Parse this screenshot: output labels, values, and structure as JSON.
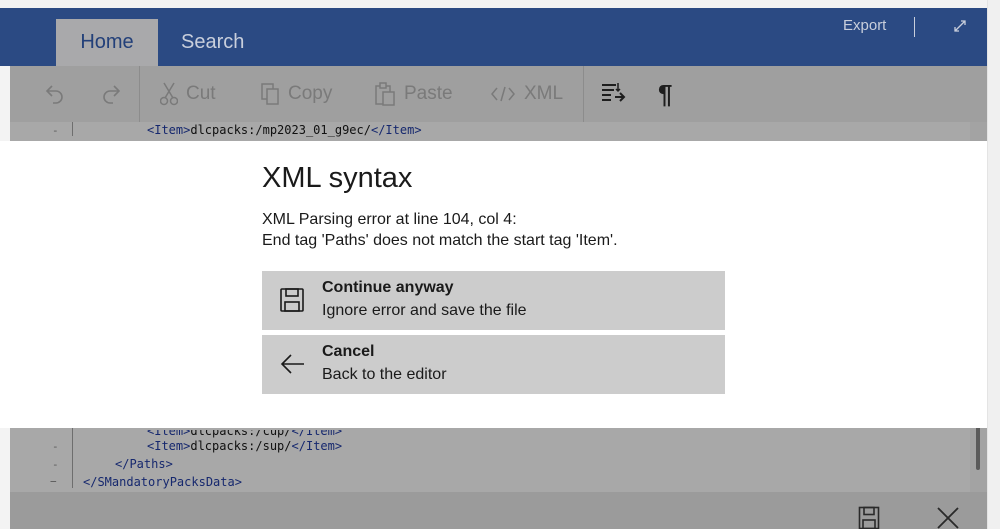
{
  "header": {
    "tabs": [
      {
        "label": "Home",
        "active": true
      },
      {
        "label": "Search",
        "active": false
      }
    ],
    "export_label": "Export",
    "expand_icon": "expand-icon",
    "colors": {
      "bar": "#2b4a83",
      "active_tab": "#a9a9ab",
      "active_tab_text": "#234079"
    }
  },
  "toolbar": {
    "undo_icon": "undo-icon",
    "redo_icon": "redo-icon",
    "cut_label": "Cut",
    "copy_label": "Copy",
    "paste_label": "Paste",
    "xml_label": "XML",
    "format_icon": "format-document-icon",
    "pilcrow": "¶"
  },
  "editor": {
    "lines_top": [
      {
        "open": "<Item>",
        "text": "dlcpacks:/mp2023_01_g9ec/",
        "close": "</Item>"
      }
    ],
    "lines_bottom": [
      {
        "open": "<Item>",
        "text": "dlcpacks:/cup/",
        "close": "</Item>"
      },
      {
        "open": "<Item>",
        "text": "dlcpacks:/sup/",
        "close": "</Item>"
      },
      {
        "tag": "</Paths>"
      },
      {
        "tag": "</SMandatoryPacksData>"
      }
    ]
  },
  "dialog": {
    "title": "XML syntax",
    "message_line1": "XML Parsing error at line 104, col 4:",
    "message_line2": "End tag 'Paths' does not match the start tag 'Item'.",
    "options": [
      {
        "title": "Continue anyway",
        "subtitle": "Ignore error and save the file",
        "icon": "save-icon"
      },
      {
        "title": "Cancel",
        "subtitle": "Back to the editor",
        "icon": "back-arrow-icon"
      }
    ]
  },
  "footer": {
    "save_icon": "save-icon",
    "close_icon": "close-icon"
  }
}
